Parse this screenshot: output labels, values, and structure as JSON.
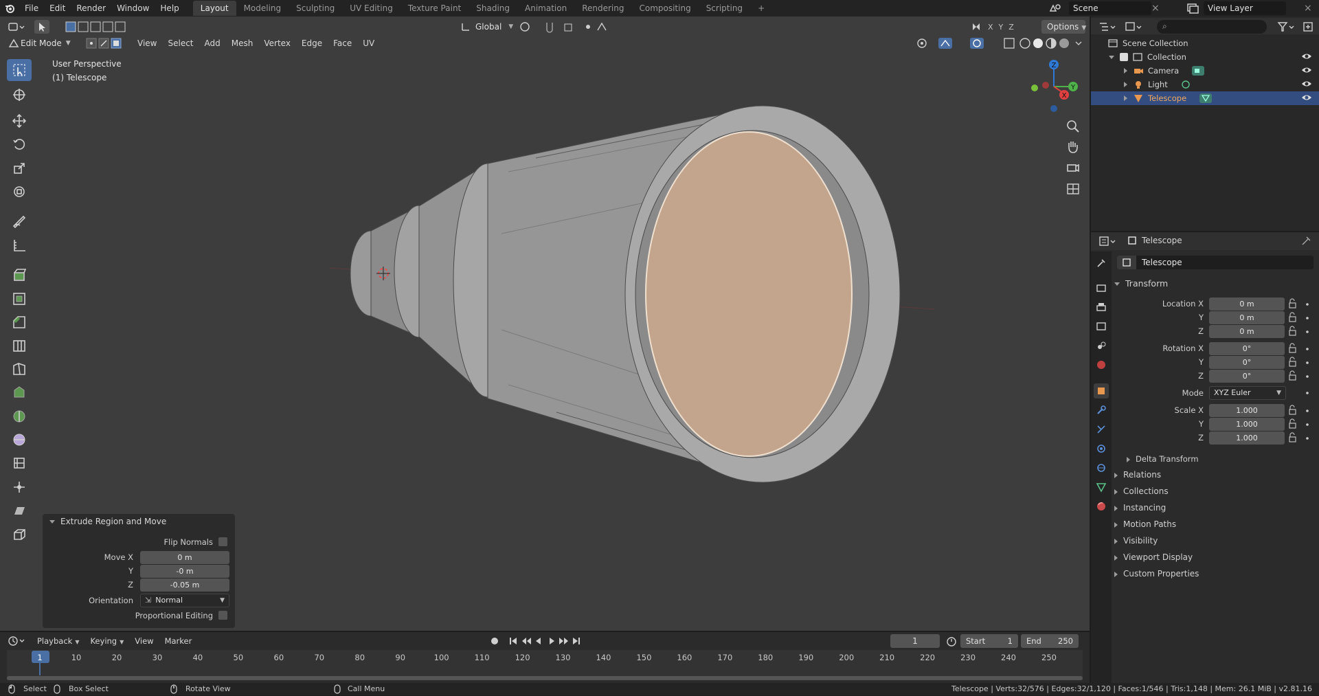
{
  "topbar": {
    "menus": [
      "File",
      "Edit",
      "Render",
      "Window",
      "Help"
    ],
    "workspaces": [
      "Layout",
      "Modeling",
      "Sculpting",
      "UV Editing",
      "Texture Paint",
      "Shading",
      "Animation",
      "Rendering",
      "Compositing",
      "Scripting"
    ],
    "active_workspace": "Layout",
    "add_tab": "+",
    "scene": "Scene",
    "view_layer": "View Layer"
  },
  "viewport_header": {
    "mode": "Edit Mode",
    "menus": [
      "View",
      "Select",
      "Add",
      "Mesh",
      "Vertex",
      "Edge",
      "Face",
      "UV"
    ],
    "transform_orientation": "Global",
    "options": "Options",
    "axes": [
      "X",
      "Y",
      "Z"
    ]
  },
  "viewport": {
    "perspective": "User Perspective",
    "object_label": "(1) Telescope",
    "gizmo": {
      "z": "Z",
      "y": "Y",
      "x": "X"
    }
  },
  "operator_panel": {
    "title": "Extrude Region and Move",
    "flip_normals": "Flip Normals",
    "move_x_label": "Move X",
    "move_x": "0 m",
    "y_label": "Y",
    "move_y": "-0 m",
    "z_label": "Z",
    "move_z": "-0.05 m",
    "orientation_label": "Orientation",
    "orientation": "Normal",
    "proportional": "Proportional Editing"
  },
  "outliner": {
    "search_placeholder": "",
    "scene_collection": "Scene Collection",
    "collection": "Collection",
    "items": [
      "Camera",
      "Light",
      "Telescope"
    ]
  },
  "properties": {
    "header_object": "Telescope",
    "object_name": "Telescope",
    "transform": "Transform",
    "location_x_label": "Location X",
    "location": [
      "0 m",
      "0 m",
      "0 m"
    ],
    "rotation_x_label": "Rotation X",
    "rotation": [
      "0°",
      "0°",
      "0°"
    ],
    "mode_label": "Mode",
    "mode": "XYZ Euler",
    "scale_x_label": "Scale X",
    "scale": [
      "1.000",
      "1.000",
      "1.000"
    ],
    "y": "Y",
    "z": "Z",
    "delta_transform": "Delta Transform",
    "sections": [
      "Relations",
      "Collections",
      "Instancing",
      "Motion Paths",
      "Visibility",
      "Viewport Display",
      "Custom Properties"
    ]
  },
  "timeline": {
    "menus": [
      "Playback",
      "Keying",
      "View",
      "Marker"
    ],
    "current_frame": "1",
    "start_label": "Start",
    "start": "1",
    "end_label": "End",
    "end": "250",
    "ticks": [
      "1",
      "10",
      "20",
      "30",
      "40",
      "50",
      "60",
      "70",
      "80",
      "90",
      "100",
      "110",
      "120",
      "130",
      "140",
      "150",
      "160",
      "170",
      "180",
      "190",
      "200",
      "210",
      "220",
      "230",
      "240",
      "250"
    ]
  },
  "statusbar": {
    "select": "Select",
    "box_select": "Box Select",
    "rotate_view": "Rotate View",
    "call_menu": "Call Menu",
    "stats": "Telescope | Verts:32/576 | Edges:32/1,120 | Faces:1/546 | Tris:1,148 | Mem: 26.1 MiB | v2.81.16"
  },
  "colors": {
    "accent": "#4a6fa5",
    "selected_row": "#334d80",
    "face_selected": "#c2a58c",
    "mesh": "#8f8f8f",
    "background": "#3d3d3d"
  }
}
